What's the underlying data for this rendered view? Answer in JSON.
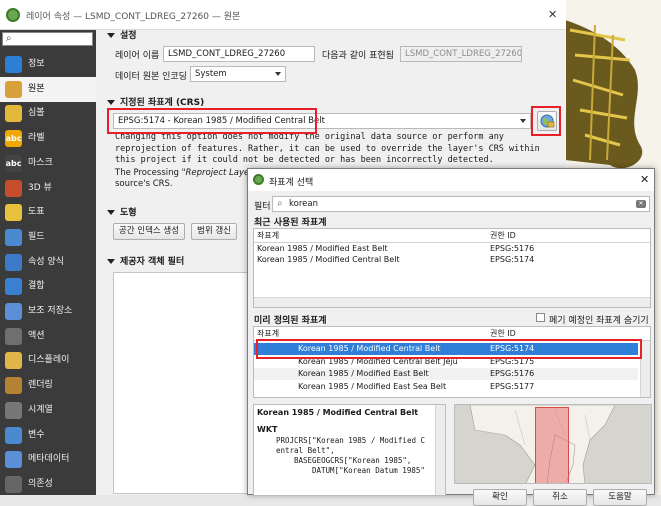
{
  "main_window": {
    "title": "레이어 속성 — LSMD_CONT_LDREG_27260 — 원본",
    "close_glyph": "✕",
    "search_placeholder": ""
  },
  "sidebar": {
    "items": [
      {
        "label": "정보",
        "icon": "info-icon"
      },
      {
        "label": "원본",
        "icon": "source-icon"
      },
      {
        "label": "심볼",
        "icon": "symbology-icon"
      },
      {
        "label": "라벨",
        "icon": "labels-icon",
        "badge": "abc"
      },
      {
        "label": "마스크",
        "icon": "mask-icon",
        "badge": "abc"
      },
      {
        "label": "3D 뷰",
        "icon": "3d-view-icon"
      },
      {
        "label": "도표",
        "icon": "diagram-icon"
      },
      {
        "label": "필드",
        "icon": "fields-icon"
      },
      {
        "label": "속성 양식",
        "icon": "attributes-form-icon"
      },
      {
        "label": "결합",
        "icon": "joins-icon"
      },
      {
        "label": "보조 저장소",
        "icon": "auxiliary-storage-icon"
      },
      {
        "label": "액션",
        "icon": "actions-icon"
      },
      {
        "label": "디스플레이",
        "icon": "display-icon"
      },
      {
        "label": "렌더링",
        "icon": "rendering-icon"
      },
      {
        "label": "시계열",
        "icon": "temporal-icon"
      },
      {
        "label": "변수",
        "icon": "variables-icon"
      },
      {
        "label": "메타데이터",
        "icon": "metadata-icon"
      },
      {
        "label": "의존성",
        "icon": "dependencies-icon"
      }
    ]
  },
  "settings": {
    "section_title": "설정",
    "layer_name_label": "레이어 이름",
    "layer_name_value": "LSMD_CONT_LDREG_27260",
    "display_as_label": "다음과 같이 표현됨",
    "display_as_value": "LSMD_CONT_LDREG_27260",
    "encoding_label": "데이터 원본 인코딩",
    "encoding_value": "System"
  },
  "crs": {
    "section_title": "지정된 좌표계 (CRS)",
    "value": "EPSG:5174 - Korean 1985 / Modified Central Belt",
    "warning": "Changing this option does not modify the original data source or perform any reprojection of features. Rather, it can be used to override the layer's CRS within this project if it could not be detected or has been incorrectly detected.",
    "processing_prefix": "The Processing ",
    "processing_italic": "\"Reproject Layer",
    "processing_line2": "source's CRS."
  },
  "geometry": {
    "section_title": "도형",
    "button1": "공간 인덱스 생성",
    "button2": "범위 갱신"
  },
  "provider_filter": {
    "section_title": "제공자 객체 필터"
  },
  "crs_dialog": {
    "title": "좌표계 선택",
    "filter_label": "필터",
    "filter_value": "korean",
    "recent_title": "최근 사용된 좌표계",
    "col_crs": "좌표계",
    "col_authority": "권한 ID",
    "recent_rows": [
      {
        "name": "Korean 1985 / Modified East Belt",
        "auth": "EPSG:5176"
      },
      {
        "name": "Korean 1985 / Modified Central Belt",
        "auth": "EPSG:5174"
      }
    ],
    "predefined_title": "미리 정의된 좌표계",
    "hide_deprecated": "폐기 예정인 좌표계 숨기기",
    "predefined_rows": [
      {
        "name": "Korean 1985 / Modified Central Belt",
        "auth": "EPSG:5174"
      },
      {
        "name": "Korean 1985 / Modified Central Belt Jeju",
        "auth": "EPSG:5175"
      },
      {
        "name": "Korean 1985 / Modified East Belt",
        "auth": "EPSG:5176"
      },
      {
        "name": "Korean 1985 / Modified East Sea Belt",
        "auth": "EPSG:5177"
      }
    ],
    "selected_name": "Korean 1985 / Modified Central Belt",
    "wkt_label": "WKT",
    "wkt_lines": [
      "PROJCRS[\"Korean 1985 / Modified C",
      "entral Belt\",",
      "BASEGEOGCRS[\"Korean 1985\",",
      "DATUM[\"Korean Datum 1985\""
    ],
    "btn_ok": "확인",
    "btn_cancel": "취소",
    "btn_help": "도움말"
  },
  "colors": {
    "sidebar_bg": "#3b3b3b",
    "selection": "#2f7fd8",
    "highlight_red": "#e8202a"
  }
}
